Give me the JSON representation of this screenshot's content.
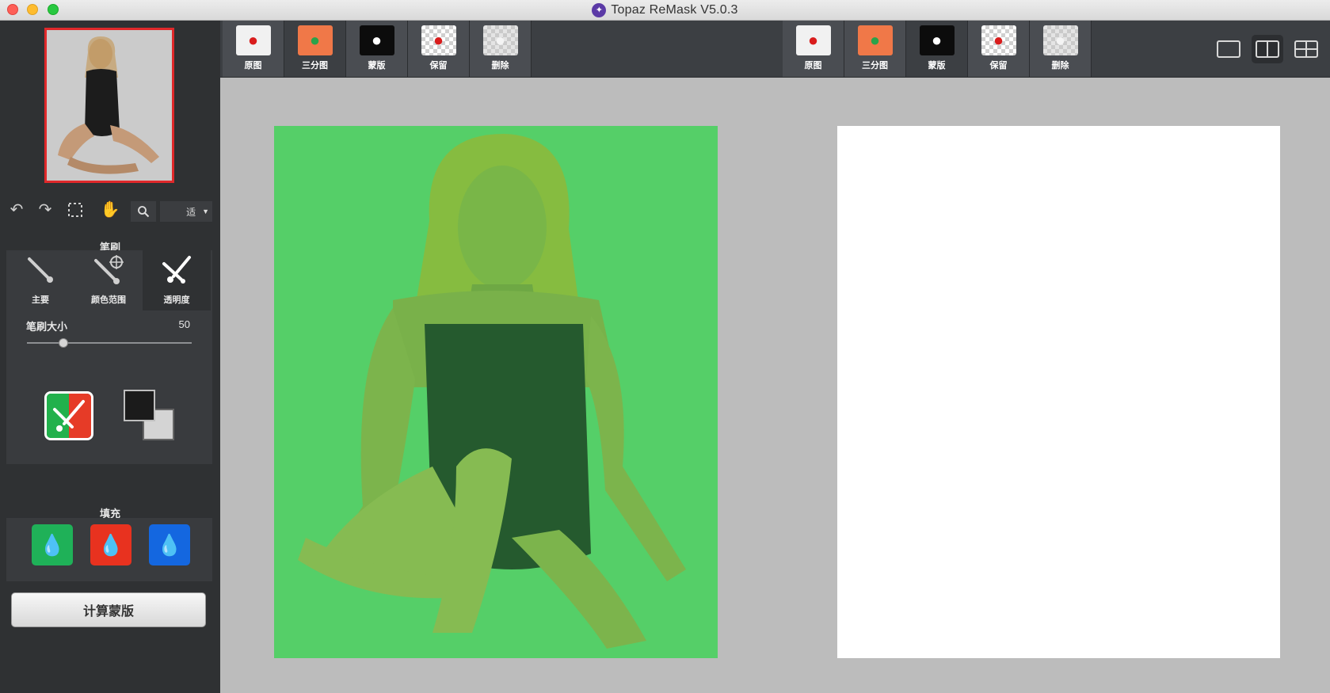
{
  "window": {
    "title": "Topaz ReMask V5.0.3"
  },
  "sidebar": {
    "brush": {
      "section_title": "笔刷",
      "tabs": [
        {
          "label": "主要"
        },
        {
          "label": "颜色范围"
        },
        {
          "label": "透明度"
        }
      ],
      "size_label": "笔刷大小",
      "size_value": "50",
      "size_fraction": 0.22
    },
    "zoom": {
      "value": "适"
    },
    "fill": {
      "section_title": "填充"
    },
    "compute_button": "计算蒙版"
  },
  "toolbar": {
    "left_group": [
      {
        "label": "原图",
        "icon": "apple-original-icon"
      },
      {
        "label": "三分图",
        "icon": "apple-trimap-icon"
      },
      {
        "label": "蒙版",
        "icon": "apple-mask-icon"
      },
      {
        "label": "保留",
        "icon": "apple-keep-icon"
      },
      {
        "label": "删除",
        "icon": "apple-delete-icon"
      }
    ],
    "right_group": [
      {
        "label": "原图",
        "icon": "apple-original-icon"
      },
      {
        "label": "三分图",
        "icon": "apple-trimap-icon"
      },
      {
        "label": "蒙版",
        "icon": "apple-mask-icon"
      },
      {
        "label": "保留",
        "icon": "apple-keep-icon"
      },
      {
        "label": "删除",
        "icon": "apple-delete-icon"
      }
    ]
  },
  "colors": {
    "sidebar_bg": "#2f3133",
    "toolbar_bg": "#3c3f43",
    "canvas_bg": "#bcbcbc",
    "overlay_green": "#55cf68",
    "thumb_border": "#e0282a",
    "fill_keep": "#1fb158",
    "fill_erase": "#e8321f",
    "fill_compute": "#1467e0"
  }
}
